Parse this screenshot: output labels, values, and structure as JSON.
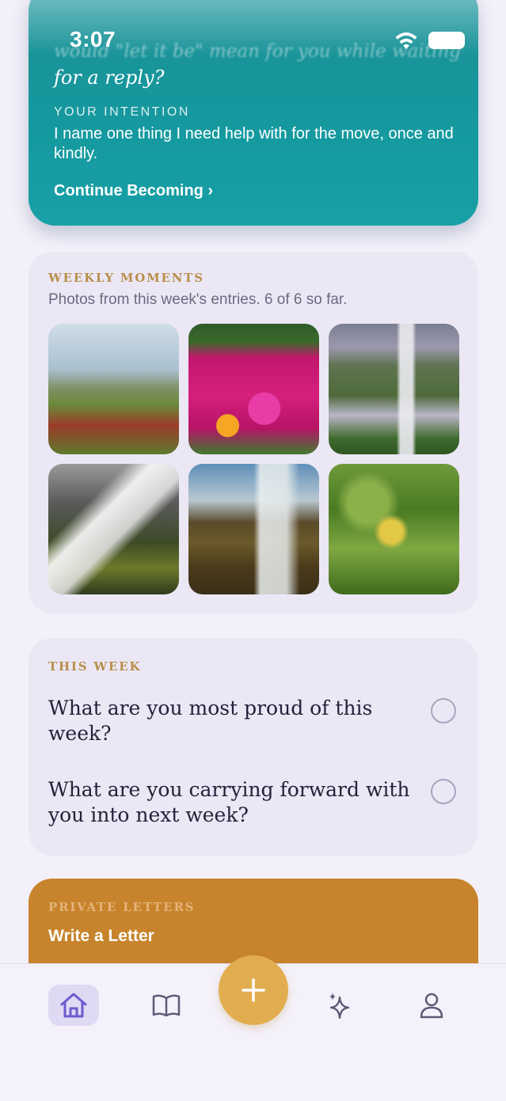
{
  "status_bar": {
    "time": "3:07"
  },
  "intention": {
    "prompt_faded": "would \"let it be\" mean for you while waiting",
    "prompt_line": "for a reply?",
    "label": "YOUR INTENTION",
    "text": "I name one thing I need help with for the move, once and kindly.",
    "link": "Continue Becoming ›"
  },
  "weekly_moments": {
    "label": "WEEKLY MOMENTS",
    "subtitle": "Photos from this week's entries. 6 of 6 so far.",
    "photos": [
      "ice-plant-flower-photo",
      "pink-flowers-photo",
      "waterfall-cliff-photo",
      "waterfall-rocks-photo",
      "waterfall-river-photo",
      "lemon-tree-photo"
    ]
  },
  "this_week": {
    "label": "THIS WEEK",
    "questions": [
      {
        "text": "What are you most proud of this week?",
        "checked": false
      },
      {
        "text": "What are you carrying forward with you into next week?",
        "checked": false
      }
    ]
  },
  "private_letters": {
    "label": "PRIVATE LETTERS",
    "title": "Write a Letter"
  },
  "tab_bar": {
    "tabs": [
      {
        "name": "home",
        "icon": "home-icon",
        "active": true
      },
      {
        "name": "journal",
        "icon": "book-icon",
        "active": false
      },
      {
        "name": "add",
        "icon": "plus-icon",
        "active": false
      },
      {
        "name": "insights",
        "icon": "sparkles-icon",
        "active": false
      },
      {
        "name": "profile",
        "icon": "person-icon",
        "active": false
      }
    ]
  },
  "colors": {
    "teal": "#15999f",
    "gold": "#e2ad4f",
    "letters_orange": "#c7842c",
    "accent_purple": "#6c5ccf",
    "label_gold": "#b98f4b"
  }
}
